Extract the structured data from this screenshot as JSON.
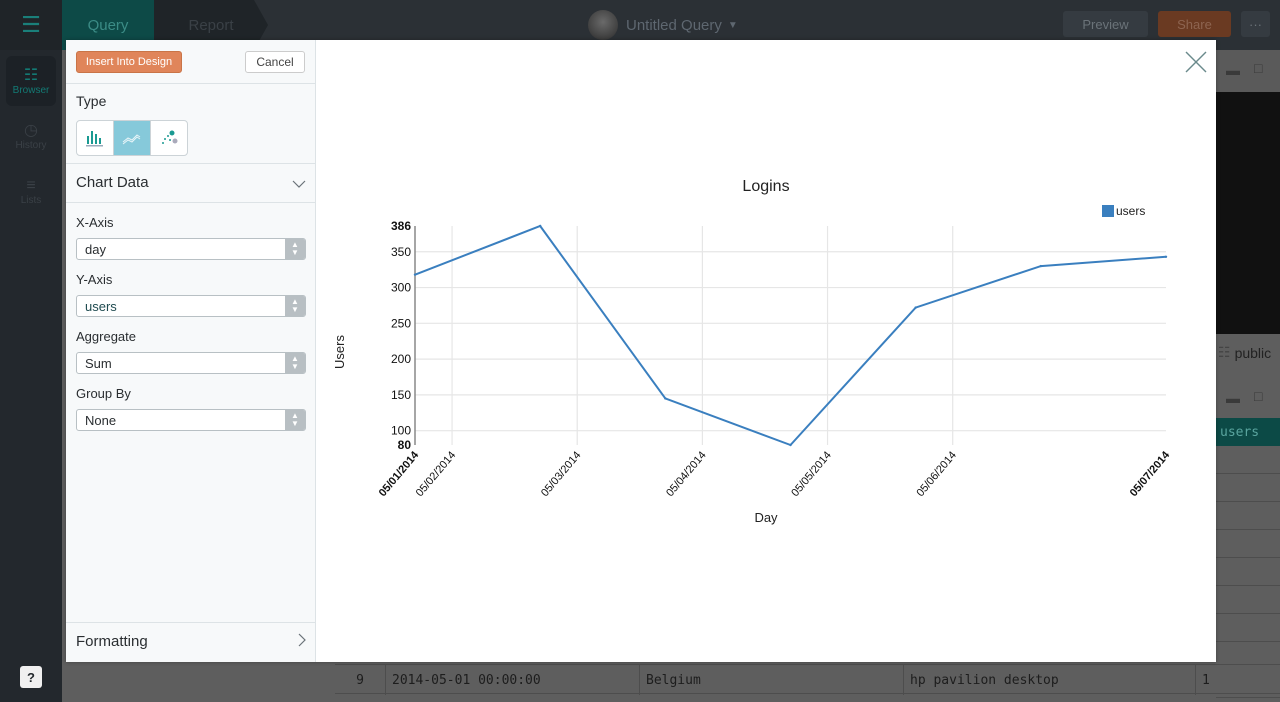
{
  "app": {
    "tabs": [
      {
        "label": "Query"
      },
      {
        "label": "Report"
      }
    ],
    "query_title": "Untitled Query",
    "buttons": {
      "preview": "Preview",
      "share": "Share",
      "more": "···"
    },
    "nav": [
      {
        "label": "Browser",
        "icon": "database-icon"
      },
      {
        "label": "History",
        "icon": "clock-icon"
      },
      {
        "label": "Lists",
        "icon": "list-add-icon"
      }
    ],
    "help_label": "?",
    "schema_label": "public",
    "results_header": "users",
    "visible_row": {
      "index": "9",
      "day": "2014-05-01 00:00:00",
      "country": "Belgium",
      "device": "hp pavilion desktop",
      "users": "1"
    }
  },
  "modal": {
    "insert_label": "Insert Into Design",
    "cancel_label": "Cancel",
    "type_label": "Type",
    "types": [
      {
        "name": "bar",
        "icon": "bar-chart-icon",
        "active": false
      },
      {
        "name": "line",
        "icon": "line-chart-icon",
        "active": true
      },
      {
        "name": "scatter",
        "icon": "scatter-chart-icon",
        "active": false
      }
    ],
    "chart_data_label": "Chart Data",
    "fields": [
      {
        "label": "X-Axis",
        "value": "day"
      },
      {
        "label": "Y-Axis",
        "value": "users"
      },
      {
        "label": "Aggregate",
        "value": "Sum"
      },
      {
        "label": "Group By",
        "value": "None"
      }
    ],
    "formatting_label": "Formatting"
  },
  "colors": {
    "accent": "#e0855a",
    "series": "#3a7fbf",
    "teal": "#137a74",
    "active_type": "#86c9da"
  },
  "chart_data": {
    "type": "line",
    "title": "Logins",
    "xlabel": "Day",
    "ylabel": "Users",
    "legend": {
      "entries": [
        "users"
      ],
      "placement": "top-right"
    },
    "grid": true,
    "x": [
      "05/01/2014",
      "05/02/2014",
      "05/03/2014",
      "05/04/2014",
      "05/05/2014",
      "05/06/2014",
      "05/07/2014"
    ],
    "series": [
      {
        "name": "users",
        "values": [
          318,
          386,
          145,
          80,
          272,
          330,
          343
        ]
      }
    ],
    "x_tick_labels": [
      "05/01/2014",
      "05/02/2014",
      "05/03/2014",
      "05/04/2014",
      "05/05/2014",
      "05/06/2014",
      "05/07/2014"
    ],
    "x_tick_offset_days": 0.296,
    "y_tick_labels": [
      80,
      100,
      150,
      200,
      250,
      300,
      350,
      386
    ],
    "ylim": [
      80,
      386
    ]
  }
}
